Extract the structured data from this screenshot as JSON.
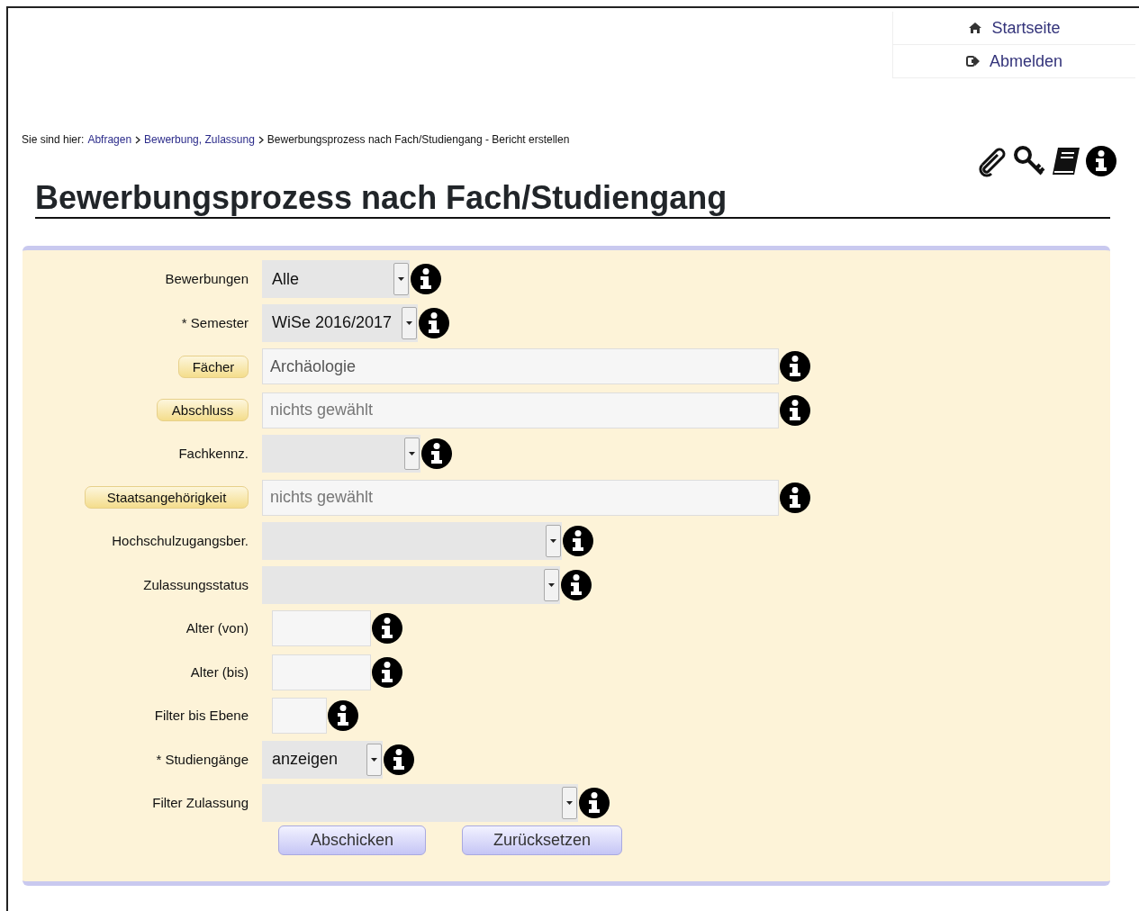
{
  "nav": [
    {
      "kind": "home",
      "label": "Startseite"
    },
    {
      "kind": "logout",
      "label": "Abmelden"
    }
  ],
  "breadcrumb": {
    "prefix": "Sie sind hier:",
    "links": [
      "Abfragen",
      "Bewerbung, Zulassung"
    ],
    "current": "Bewerbungsprozess nach Fach/Studiengang - Bericht erstellen"
  },
  "title": "Bewerbungsprozess nach Fach/Studiengang",
  "rows": [
    {
      "kind": "select",
      "label": "Bewerbungen",
      "value": "Alle"
    },
    {
      "kind": "select",
      "label": "* Semester",
      "value": "WiSe 2016/2017"
    },
    {
      "kind": "picker",
      "label": "Fächer",
      "value": "Archäologie"
    },
    {
      "kind": "picker",
      "label": "Abschluss",
      "placeholder": "nichts gewählt"
    },
    {
      "kind": "select",
      "label": "Fachkennz."
    },
    {
      "kind": "picker",
      "label": "Staatsangehörigkeit",
      "placeholder": "nichts gewählt"
    },
    {
      "kind": "select",
      "label": "Hochschulzugangsber."
    },
    {
      "kind": "select",
      "label": "Zulassungsstatus"
    },
    {
      "kind": "text",
      "label": "Alter (von)"
    },
    {
      "kind": "text",
      "label": "Alter (bis)"
    },
    {
      "kind": "text",
      "label": "Filter bis Ebene"
    },
    {
      "kind": "select",
      "label": "* Studiengänge",
      "value": "anzeigen"
    },
    {
      "kind": "select",
      "label": "Filter Zulassung"
    }
  ],
  "buttons": [
    "Abschicken",
    "Zurücksetzen"
  ]
}
